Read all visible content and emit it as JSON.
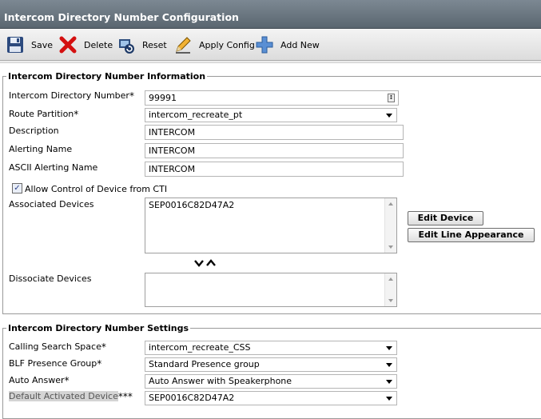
{
  "title": "Intercom Directory Number Configuration",
  "toolbar": {
    "save": "Save",
    "delete": "Delete",
    "reset": "Reset",
    "apply_config": "Apply Config",
    "add_new": "Add New"
  },
  "info": {
    "legend": "Intercom Directory Number Information",
    "intercom_dn_label": "Intercom Directory Number",
    "intercom_dn_value": "99991",
    "route_partition_label": "Route Partition",
    "route_partition_value": "intercom_recreate_pt",
    "description_label": "Description",
    "description_value": "INTERCOM",
    "alerting_name_label": "Alerting Name",
    "alerting_name_value": "INTERCOM",
    "ascii_alerting_label": "ASCII Alerting Name",
    "ascii_alerting_value": "INTERCOM",
    "cti_label": "Allow Control of Device from CTI",
    "cti_checked": true,
    "associated_label": "Associated Devices",
    "associated_items": [
      "SEP0016C82D47A2"
    ],
    "edit_device": "Edit Device",
    "edit_line": "Edit Line Appearance",
    "dissociate_label": "Dissociate Devices"
  },
  "settings": {
    "legend": "Intercom Directory Number Settings",
    "css_label": "Calling Search Space",
    "css_value": "intercom_recreate_CSS",
    "blf_label": "BLF Presence Group",
    "blf_value": "Standard Presence group",
    "auto_answer_label": "Auto Answer",
    "auto_answer_value": "Auto Answer with Speakerphone",
    "default_device_label": "Default Activated Device",
    "default_device_value": "SEP0016C82D47A2"
  },
  "required_mark": "*",
  "triple_mark": "***",
  "colors": {
    "titlebar": "#6b7781",
    "selected_label_bg": "#d4d4d4"
  }
}
